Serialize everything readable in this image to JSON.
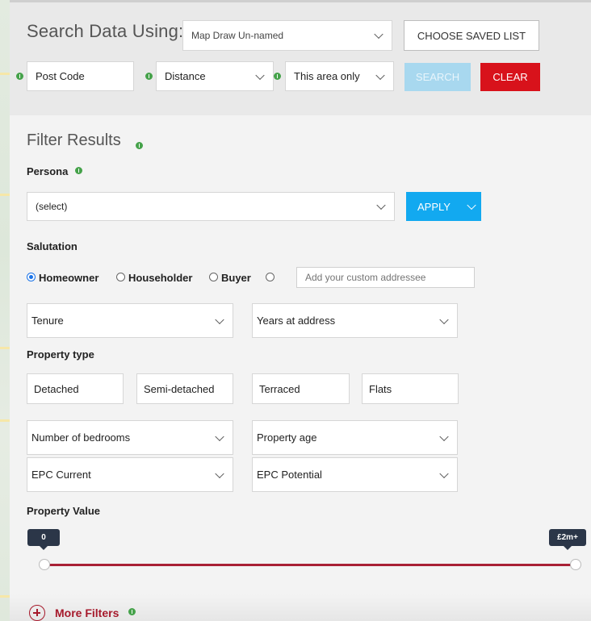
{
  "search": {
    "title": "Search Data Using:",
    "map_select": "Map Draw Un-named",
    "choose_saved_list": "CHOOSE SAVED LIST",
    "postcode_placeholder": "Post Code",
    "distance": "Distance",
    "area": "This area only",
    "search_label": "SEARCH",
    "clear_label": "CLEAR"
  },
  "filters": {
    "title": "Filter Results",
    "persona_label": "Persona",
    "persona_select": "(select)",
    "apply_label": "APPLY",
    "salutation_label": "Salutation",
    "salutation_options": [
      "Homeowner",
      "Householder",
      "Buyer"
    ],
    "salutation_selected": "Homeowner",
    "custom_addressee_placeholder": "Add your custom addressee",
    "tenure": "Tenure",
    "years_at_address": "Years at address",
    "property_type_label": "Property type",
    "property_types": [
      "Detached",
      "Semi-detached",
      "Terraced",
      "Flats"
    ],
    "number_of_bedrooms": "Number of bedrooms",
    "property_age": "Property age",
    "epc_current": "EPC Current",
    "epc_potential": "EPC Potential",
    "property_value_label": "Property Value",
    "value_min": "0",
    "value_max": "£2m+",
    "more_filters": "More Filters"
  },
  "colors": {
    "clear": "#d8121b",
    "apply": "#12a9f0",
    "search_disabled": "#a8d8ef",
    "info": "#45a24a",
    "slider": "#a82035"
  }
}
